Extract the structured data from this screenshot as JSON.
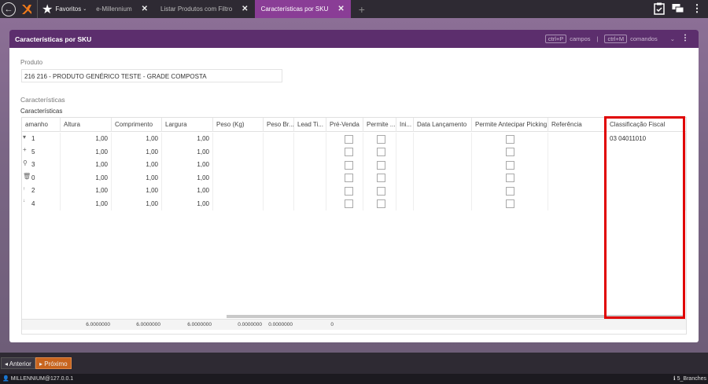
{
  "topbar": {
    "favorites_label": "Favoritos",
    "tabs": [
      {
        "label": "e-Millennium"
      },
      {
        "label": "Listar Produtos com Filtro"
      },
      {
        "label": "Características por SKU"
      }
    ],
    "add_tab": "+"
  },
  "panel": {
    "title": "Características por SKU",
    "shortcut_fields_key": "ctrl+P",
    "shortcut_fields_label": "campos",
    "shortcut_commands_key": "ctrl+M",
    "shortcut_commands_label": "comandos",
    "separator": "|"
  },
  "product": {
    "label": "Produto",
    "value": "216 216 - PRODUTO GENÉRICO TESTE - GRADE COMPOSTA"
  },
  "section": {
    "title": "Características",
    "grid_title": "Características"
  },
  "grid": {
    "columns": [
      "amanho",
      "Altura",
      "Comprimento",
      "Largura",
      "Peso (Kg)",
      "Peso Br...",
      "Lead Ti...",
      "Pré-Venda",
      "Permite ...",
      "Ini...",
      "Data Lançamento",
      "Permite Antecipar Picking",
      "Referência",
      "Classificação Fiscal"
    ],
    "rows": [
      {
        "size": "1",
        "altura": "1,00",
        "comprimento": "1,00",
        "largura": "1,00",
        "classificacao": "03 04011010"
      },
      {
        "size": "5",
        "altura": "1,00",
        "comprimento": "1,00",
        "largura": "1,00",
        "classificacao": ""
      },
      {
        "size": "3",
        "altura": "1,00",
        "comprimento": "1,00",
        "largura": "1,00",
        "classificacao": ""
      },
      {
        "size": "0",
        "altura": "1,00",
        "comprimento": "1,00",
        "largura": "1,00",
        "classificacao": ""
      },
      {
        "size": "2",
        "altura": "1,00",
        "comprimento": "1,00",
        "largura": "1,00",
        "classificacao": ""
      },
      {
        "size": "4",
        "altura": "1,00",
        "comprimento": "1,00",
        "largura": "1,00",
        "classificacao": ""
      }
    ],
    "totals": {
      "altura": "6.0000000",
      "comprimento": "6.0000000",
      "largura": "6.0000000",
      "peso": "0.0000000",
      "peso_bruto": "0.0000000",
      "lead": "0"
    }
  },
  "bottom": {
    "prev_label": "Anterior",
    "next_label": "Próximo"
  },
  "status": {
    "user": "MILLENNIUM@127.0.0.1",
    "branches": "5_Branches"
  },
  "colors": {
    "topbar": "#2e2a33",
    "active_tab": "#8a3d96",
    "panel_header": "#5c2e6d",
    "next_button": "#c8641e",
    "highlight": "#e00000"
  }
}
